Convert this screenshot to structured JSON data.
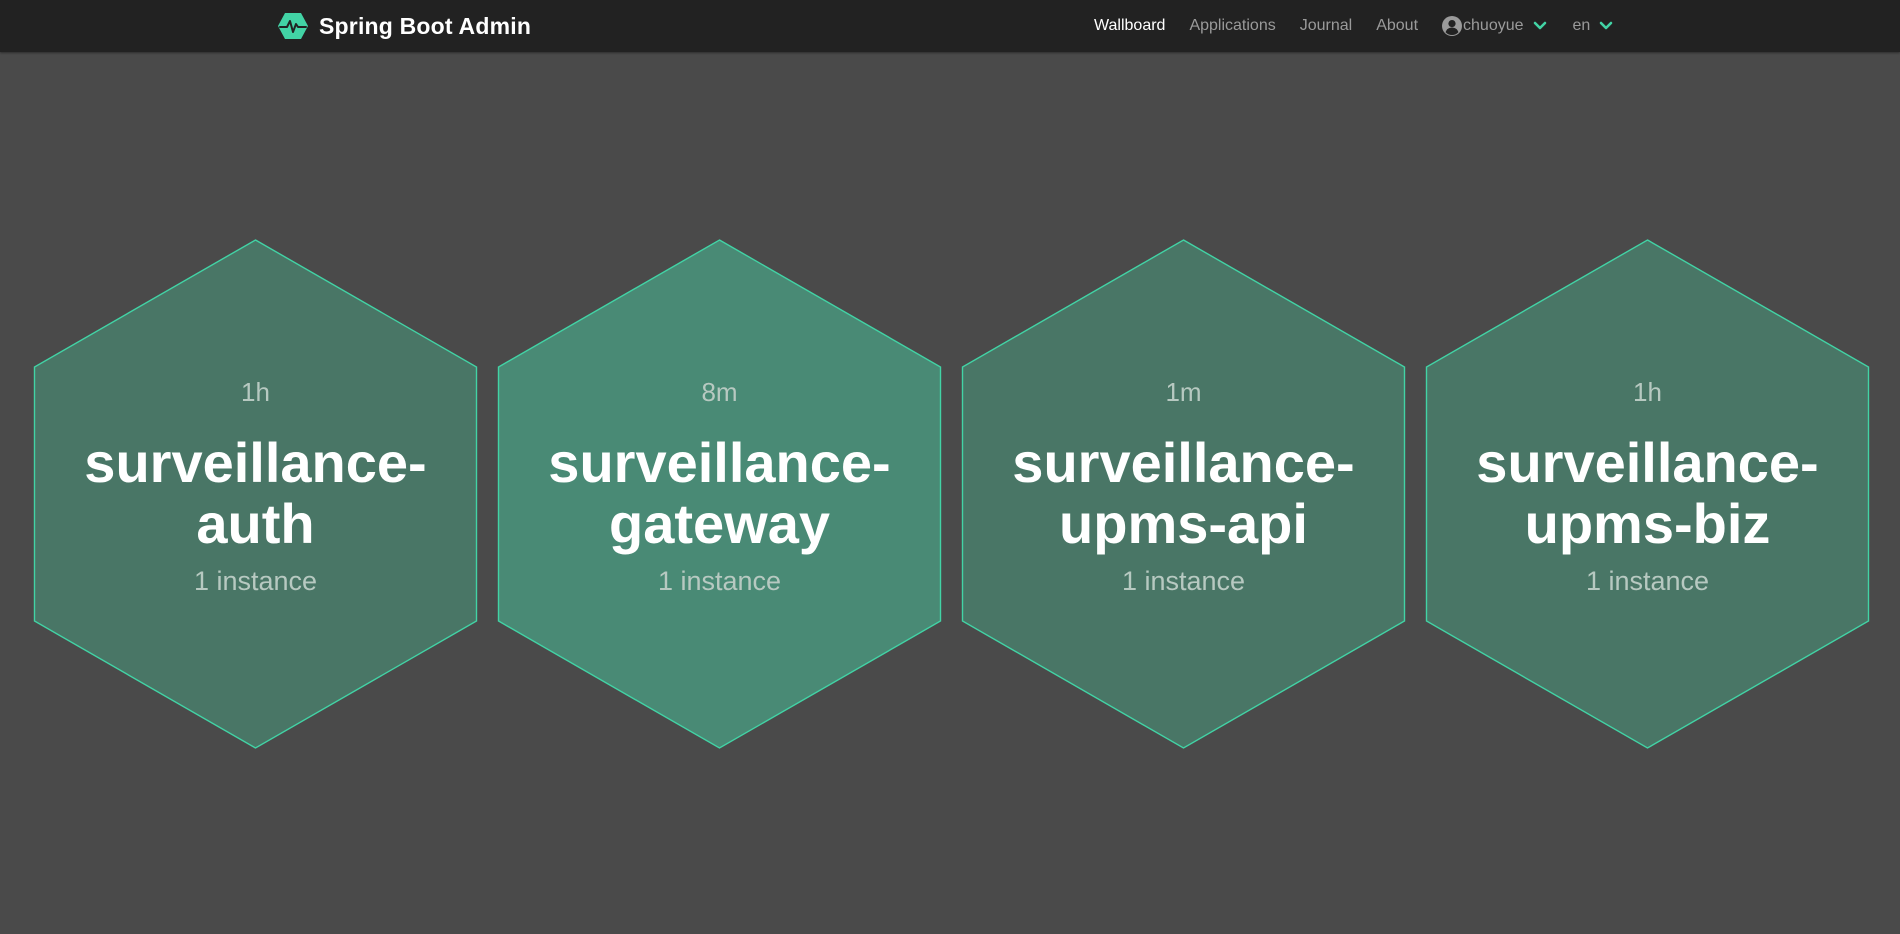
{
  "header": {
    "brand_title": "Spring Boot Admin",
    "nav": {
      "wallboard": "Wallboard",
      "applications": "Applications",
      "journal": "Journal",
      "about": "About"
    },
    "user": {
      "name": "chuoyue"
    },
    "language": "en"
  },
  "colors": {
    "accent": "#42d3a5",
    "navbar": "#222222",
    "background": "#4a4a4a",
    "hex_fill": "#497666",
    "hex_fill_highlight": "#498a75",
    "hex_stroke": "#42d3a5"
  },
  "applications": [
    {
      "name_line1": "surveillance-",
      "name_line2": "auth",
      "uptime": "1h",
      "instances": "1 instance"
    },
    {
      "name_line1": "surveillance-",
      "name_line2": "gateway",
      "uptime": "8m",
      "instances": "1 instance"
    },
    {
      "name_line1": "surveillance-",
      "name_line2": "upms-api",
      "uptime": "1m",
      "instances": "1 instance"
    },
    {
      "name_line1": "surveillance-",
      "name_line2": "upms-biz",
      "uptime": "1h",
      "instances": "1 instance"
    }
  ]
}
